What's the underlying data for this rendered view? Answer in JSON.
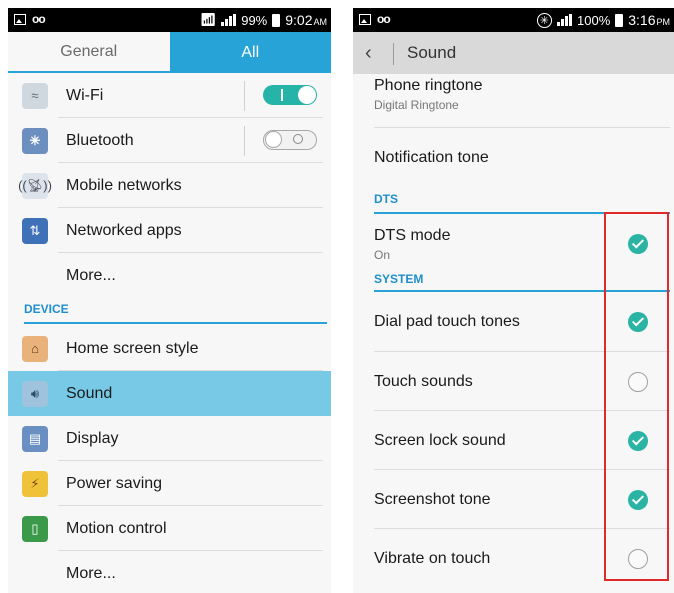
{
  "left": {
    "status": {
      "battery": "99%",
      "time": "9:02",
      "ampm": "AM"
    },
    "tabs": {
      "general": "General",
      "all": "All"
    },
    "items": [
      {
        "label": "Wi-Fi",
        "toggle": "on",
        "icon": "wifi-icon"
      },
      {
        "label": "Bluetooth",
        "toggle": "off",
        "icon": "bluetooth-icon"
      },
      {
        "label": "Mobile networks",
        "icon": "mobile-networks-icon"
      },
      {
        "label": "Networked apps",
        "icon": "networked-apps-icon"
      },
      {
        "label": "More..."
      }
    ],
    "device_header": "DEVICE",
    "device_items": [
      {
        "label": "Home screen style",
        "icon": "home-icon"
      },
      {
        "label": "Sound",
        "icon": "sound-icon",
        "selected": true
      },
      {
        "label": "Display",
        "icon": "display-icon"
      },
      {
        "label": "Power saving",
        "icon": "power-saving-icon"
      },
      {
        "label": "Motion control",
        "icon": "motion-control-icon"
      },
      {
        "label": "More..."
      }
    ]
  },
  "right": {
    "status": {
      "battery": "100%",
      "time": "3:16",
      "ampm": "PM"
    },
    "title": "Sound",
    "phone_ringtone": {
      "title": "Phone ringtone",
      "summary": "Digital Ringtone"
    },
    "notification_tone": "Notification tone",
    "dts_header": "DTS",
    "dts_mode": {
      "title": "DTS mode",
      "summary": "On",
      "checked": true
    },
    "system_header": "SYSTEM",
    "system_items": [
      {
        "title": "Dial pad touch tones",
        "checked": true
      },
      {
        "title": "Touch sounds",
        "checked": false
      },
      {
        "title": "Screen lock sound",
        "checked": true
      },
      {
        "title": "Screenshot tone",
        "checked": true
      },
      {
        "title": "Vibrate on touch",
        "checked": false
      }
    ]
  },
  "colors": {
    "accent": "#27a3d8",
    "selected": "#77c9e6",
    "check": "#2bb3a3",
    "highlight": "#e02a2a"
  }
}
